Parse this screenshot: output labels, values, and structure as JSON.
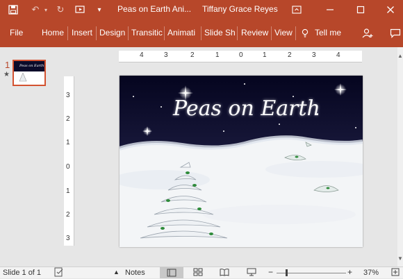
{
  "titlebar": {
    "doc_title": "Peas on Earth Ani...",
    "user_name": "Tiffany Grace Reyes"
  },
  "ribbon": {
    "tabs": [
      "File",
      "Home",
      "Insert",
      "Design",
      "Transitic",
      "Animati",
      "Slide Sh",
      "Review",
      "View"
    ],
    "tell_me": "Tell me"
  },
  "thumbnails": [
    {
      "number": "1",
      "star": "★",
      "mini_title": "Peas on Earth"
    }
  ],
  "ruler": {
    "h_ticks": [
      "4",
      "3",
      "2",
      "1",
      "0",
      "1",
      "2",
      "3",
      "4"
    ],
    "v_ticks": [
      "3",
      "2",
      "1",
      "0",
      "1",
      "2",
      "3"
    ]
  },
  "slide": {
    "title": "Peas on Earth",
    "colors": {
      "night": "#0b0b2a",
      "snow": "#f4f6f8"
    }
  },
  "statusbar": {
    "slide_info": "Slide 1 of 1",
    "notes": "Notes",
    "zoom_minus": "−",
    "zoom_plus": "+",
    "zoom_level": "37%"
  },
  "colors": {
    "accent": "#b7472a"
  }
}
